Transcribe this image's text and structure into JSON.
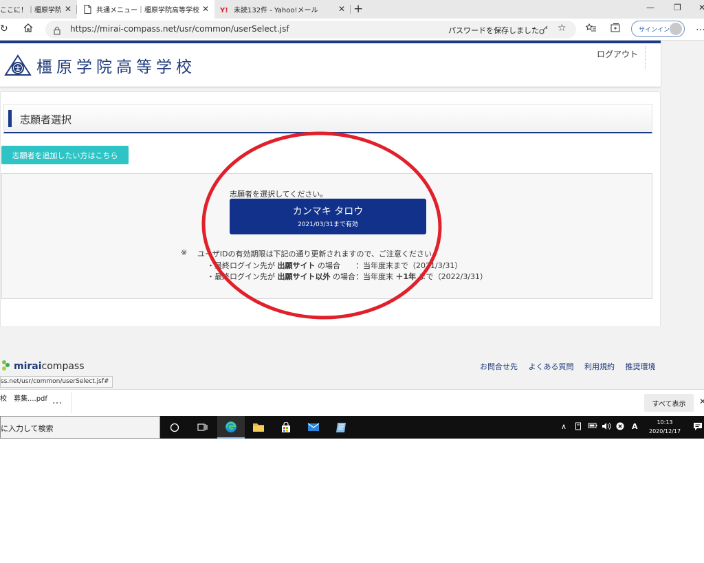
{
  "browser": {
    "tabs": [
      {
        "title": "ここに！｜橿原学院高",
        "close": "✕"
      },
      {
        "title": "共通メニュー｜橿原学院高等学校",
        "close": "✕"
      },
      {
        "title": "未読132件 - Yahoo!メール",
        "close": "✕"
      }
    ],
    "new_tab": "+",
    "url": "https://mirai-compass.net/usr/common/userSelect.jsf",
    "password_prompt": "パスワードを保存しました",
    "signin_label": "サインイン",
    "window_controls": {
      "minimize": "—",
      "restore": "❐",
      "close": "✕"
    }
  },
  "site": {
    "school_name": "橿原学院高等学校",
    "logout_label": "ログアウト"
  },
  "page": {
    "section_title": "志願者選択",
    "add_applicant_label": "志願者を追加したい方はこちら",
    "select_prompt": "志願者を選択してください。",
    "applicant": {
      "name": "カンマキ タロウ",
      "validity": "2021/03/31まで有効"
    },
    "note_mark": "※",
    "note_main": "ユーザIDの有効期限は下記の通り更新されますので、ご注意ください。",
    "note_line1_prefix": "・最終ログイン先が",
    "note_line1_bold": "出願サイト",
    "note_line1_suffix": "の場合　　：当年度末まで（2021/3/31）",
    "note_line2_prefix": "・最終ログイン先が",
    "note_line2_bold": "出願サイト以外",
    "note_line2_suffix": "の場合：当年度末",
    "note_line2_bold2": "＋1年",
    "note_line2_end": "まで（2022/3/31）"
  },
  "footer": {
    "brand_bold": "mirai",
    "brand_rest": "compass",
    "links": [
      "お問合せ先",
      "よくある質問",
      "利用規約",
      "推奨環境"
    ],
    "status_url": "ss.net/usr/common/userSelect.jsf#"
  },
  "downloads": {
    "file_label": "校　募集....pdf",
    "more": "…",
    "show_all": "すべて表示",
    "close": "✕"
  },
  "taskbar": {
    "search_placeholder": "に入力して検索",
    "time": "10:13",
    "date": "2020/12/17",
    "ime": "A"
  },
  "colors": {
    "brand_navy": "#11318a",
    "header_accent": "#1a3a8a",
    "add_button": "#2ec4c6",
    "annotation_red": "#e0202a"
  }
}
